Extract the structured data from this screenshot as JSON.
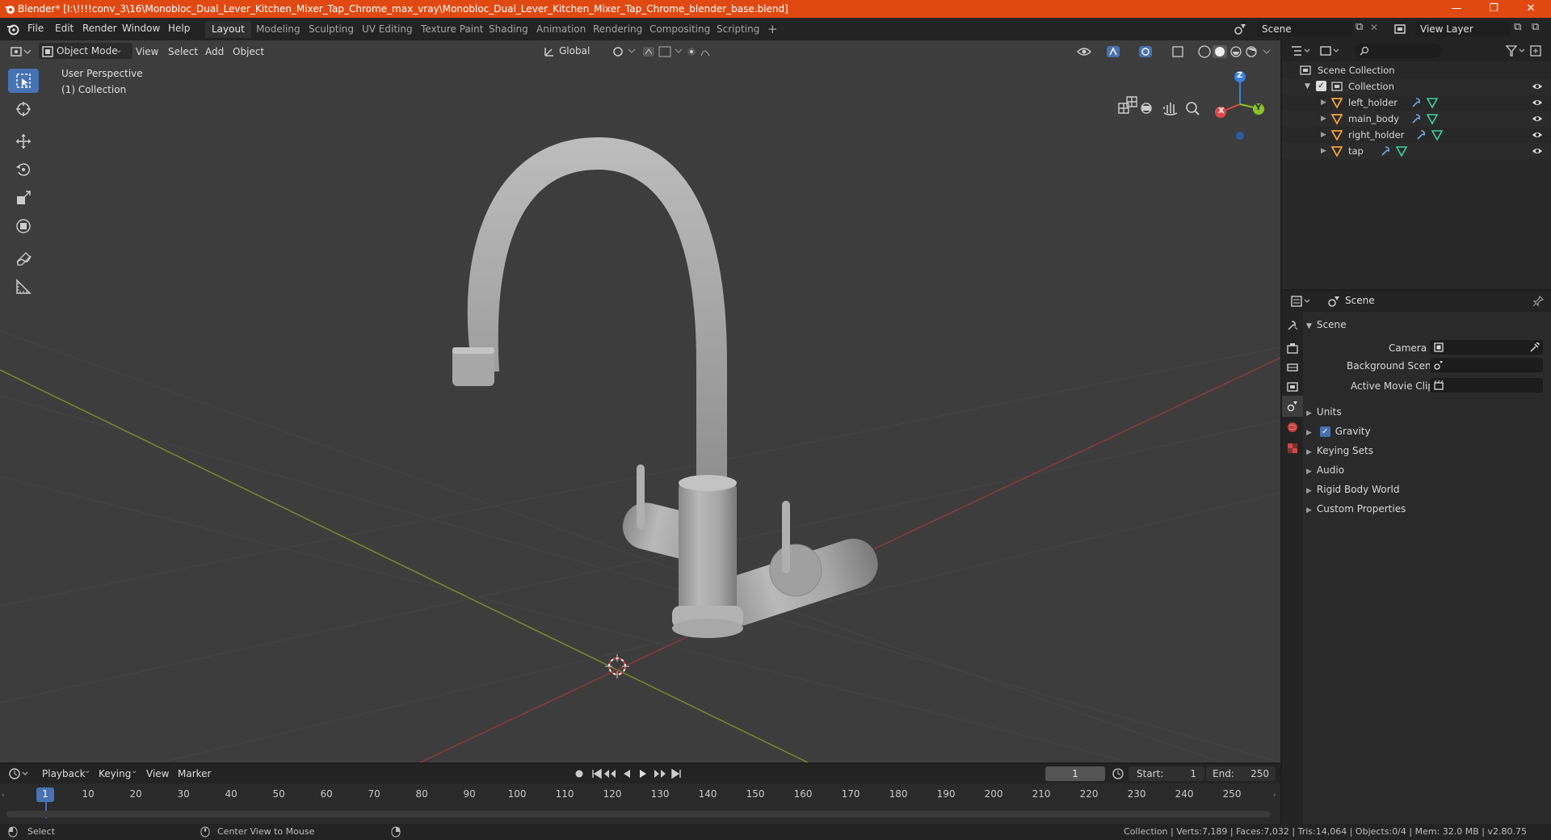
{
  "window": {
    "title": "Blender* [I:\\!!!!conv_3\\16\\Monobloc_Dual_Lever_Kitchen_Mixer_Tap_Chrome_max_vray\\Monobloc_Dual_Lever_Kitchen_Mixer_Tap_Chrome_blender_base.blend]",
    "minimize": "—",
    "restore": "❐",
    "close": "✕",
    "accent": "#e04a12"
  },
  "menu": {
    "file": "File",
    "edit": "Edit",
    "render": "Render",
    "window": "Window",
    "help": "Help"
  },
  "workspaces": [
    "Layout",
    "Modeling",
    "Sculpting",
    "UV Editing",
    "Texture Paint",
    "Shading",
    "Animation",
    "Rendering",
    "Compositing",
    "Scripting"
  ],
  "workspace_add": "+",
  "scene_field": "Scene",
  "view_layer_field": "View Layer",
  "viewport": {
    "mode": "Object Mode",
    "view": "View",
    "select": "Select",
    "add": "Add",
    "object": "Object",
    "orientation": "Global",
    "perspective": "User Perspective",
    "collection": "(1) Collection",
    "gizmo": {
      "x": "X",
      "y": "Y",
      "z": "Z"
    }
  },
  "outliner": {
    "root": "Scene Collection",
    "collection": "Collection",
    "items": [
      "left_holder",
      "main_body",
      "right_holder",
      "tap"
    ]
  },
  "properties": {
    "header": "Scene",
    "section": "Scene",
    "camera_label": "Camera",
    "background_scene_label": "Background Scene",
    "active_movie_clip_label": "Active Movie Clip",
    "panels": [
      "Units",
      "Gravity",
      "Keying Sets",
      "Audio",
      "Rigid Body World",
      "Custom Properties"
    ]
  },
  "timeline": {
    "playback": "Playback",
    "keying": "Keying",
    "view": "View",
    "marker": "Marker",
    "current_frame": "1",
    "start_label": "Start:",
    "start": "1",
    "end_label": "End:",
    "end": "250",
    "ticks": [
      "1",
      "10",
      "20",
      "30",
      "40",
      "50",
      "60",
      "70",
      "80",
      "90",
      "100",
      "110",
      "120",
      "130",
      "140",
      "150",
      "160",
      "170",
      "180",
      "190",
      "200",
      "210",
      "220",
      "230",
      "240",
      "250"
    ]
  },
  "status": {
    "select": "Select",
    "center_view": "Center View to Mouse",
    "stats": "Collection | Verts:7,189 | Faces:7,032 | Tris:14,064 | Objects:0/4 | Mem: 32.0 MB | v2.80.75"
  }
}
